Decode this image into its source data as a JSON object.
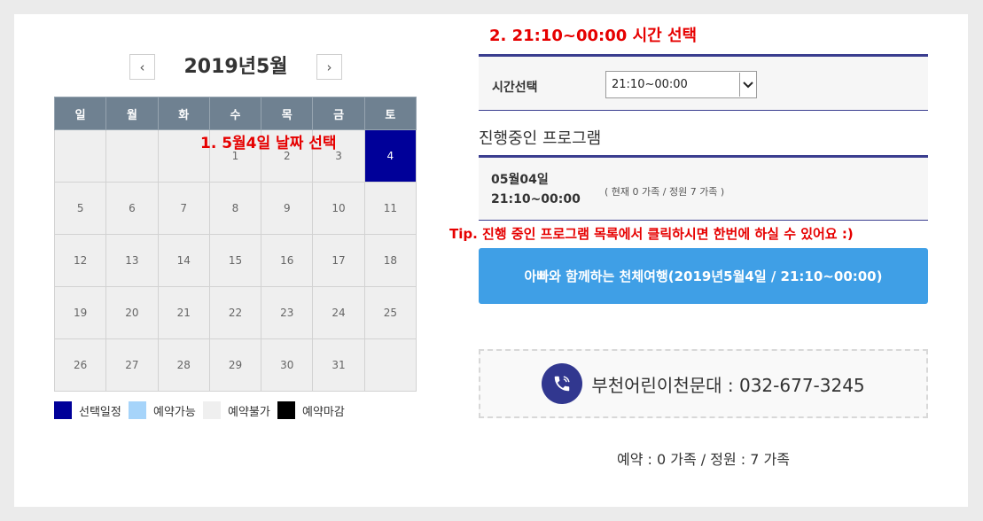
{
  "calendar": {
    "title": "2019년5월",
    "prev_label": "‹",
    "next_label": "›",
    "weekdays": [
      "일",
      "월",
      "화",
      "수",
      "목",
      "금",
      "토"
    ],
    "weeks": [
      [
        "",
        "",
        "",
        "1",
        "2",
        "3",
        "4"
      ],
      [
        "5",
        "6",
        "7",
        "8",
        "9",
        "10",
        "11"
      ],
      [
        "12",
        "13",
        "14",
        "15",
        "16",
        "17",
        "18"
      ],
      [
        "19",
        "20",
        "21",
        "22",
        "23",
        "24",
        "25"
      ],
      [
        "26",
        "27",
        "28",
        "29",
        "30",
        "31",
        ""
      ]
    ],
    "selected_day": "4"
  },
  "annotations": {
    "step1": "1. 5월4일 날짜 선택",
    "step2": "2. 21:10~00:00 시간 선택",
    "tip": "Tip. 진행 중인 프로그램 목록에서 클릭하시면 한번에 하실 수 있어요 :)"
  },
  "legend": [
    {
      "label": "선택일정",
      "color": "#000099"
    },
    {
      "label": "예약가능",
      "color": "#a6d4fa"
    },
    {
      "label": "예약불가",
      "color": "#efefef"
    },
    {
      "label": "예약마감",
      "color": "#000000"
    }
  ],
  "time_select": {
    "label": "시간선택",
    "value": "21:10~00:00",
    "arrow": "chevron-down-icon"
  },
  "programs": {
    "heading": "진행중인 프로그램",
    "date": "05월04일",
    "time": "21:10~00:00",
    "count": "( 현재 0 가족 / 정원 7 가족 )"
  },
  "program_button": {
    "label": "아빠와 함께하는 천체여행(2019년5월4일 / 21:10~00:00)"
  },
  "contact": {
    "icon": "phone-icon",
    "text": "부천어린이천문대 : 032-677-3245"
  },
  "capacity_text": "예약 : 0 가족 / 정원 : 7 가족",
  "colors": {
    "accent_blue": "#3f9fe6",
    "header_gray": "#6f8191",
    "border_navy": "#3a3d8f",
    "annotation_red": "#e60000"
  }
}
